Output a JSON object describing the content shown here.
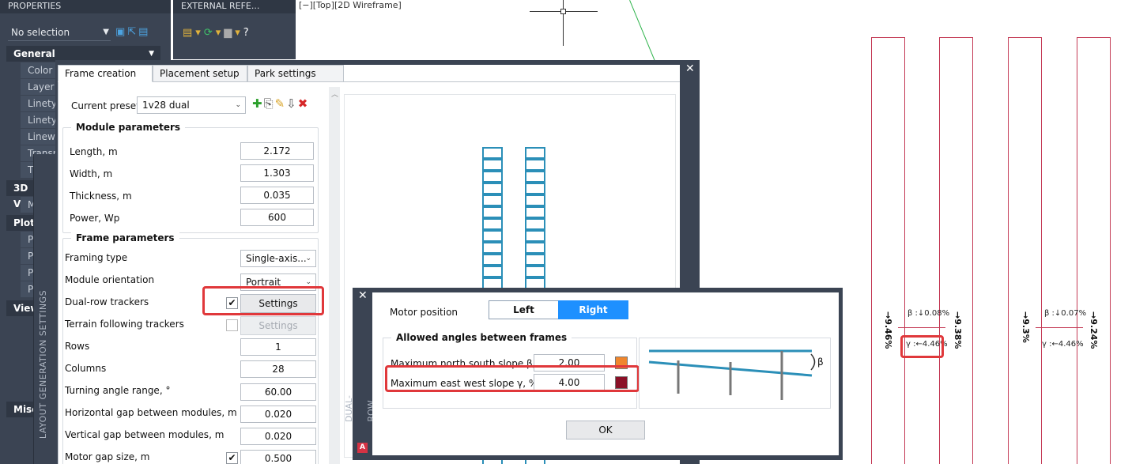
{
  "palette": {
    "title": "PROPERTIES",
    "selection": "No selection",
    "categories": {
      "general": "General",
      "three_d": "3D V",
      "plot": "Plot",
      "view": "View",
      "misc": "Misc"
    },
    "general_props": [
      "Color",
      "Layer",
      "Linety",
      "Linety",
      "Linew",
      "Transp",
      "T"
    ],
    "vertical_label": "LAYOUT GENERATION SETTINGS"
  },
  "external": {
    "title": "EXTERNAL REFE..."
  },
  "viewport": {
    "label": "[−][Top][2D Wireframe]"
  },
  "drawing": {
    "strips": [
      {
        "beta": "β :↓0.08%",
        "gamma": "γ :←4.46%",
        "left": "→9.46%",
        "right": "→9.38%"
      },
      {
        "beta": "β :↓0.07%",
        "gamma": "γ :←4.46%",
        "left": "→9.3%",
        "right": "→9.24%"
      }
    ]
  },
  "dialog": {
    "tabs": [
      "Frame creation",
      "Placement setup",
      "Park settings"
    ],
    "preset_label": "Current preset",
    "preset_value": "1v28 dual",
    "module_group": "Module parameters",
    "module_rows": [
      {
        "label": "Length, m",
        "value": "2.172"
      },
      {
        "label": "Width, m",
        "value": "1.303"
      },
      {
        "label": "Thickness, m",
        "value": "0.035"
      },
      {
        "label": "Power, Wp",
        "value": "600"
      }
    ],
    "frame_group": "Frame parameters",
    "framing_type_label": "Framing type",
    "framing_type_value": "Single-axis...",
    "orientation_label": "Module orientation",
    "orientation_value": "Portrait",
    "dual_row_label": "Dual-row trackers",
    "terrain_label": "Terrain following trackers",
    "settings_label": "Settings",
    "frame_rows": [
      {
        "label": "Rows",
        "value": "1"
      },
      {
        "label": "Columns",
        "value": "28"
      },
      {
        "label": "Turning angle range, °",
        "value": "60.00"
      },
      {
        "label": "Horizontal gap between modules, m",
        "value": "0.020"
      },
      {
        "label": "Vertical gap between modules, m",
        "value": "0.020"
      }
    ],
    "motor_gap_label": "Motor gap size, m",
    "motor_gap_value": "0.500"
  },
  "dualrow": {
    "side_label": "DUAL-ROW",
    "motor_position_label": "Motor position",
    "left_label": "Left",
    "right_label": "Right",
    "angles_group": "Allowed angles between frames",
    "north_south_label": "Maximum north south slope β, %",
    "north_south_value": "2.00",
    "east_west_label": "Maximum east west slope γ, %",
    "east_west_value": "4.00",
    "beta_symbol": "β",
    "ok_label": "OK",
    "colors": {
      "north_south": "#f0862d",
      "east_west": "#8b1026",
      "selected": "#1e90ff"
    }
  }
}
